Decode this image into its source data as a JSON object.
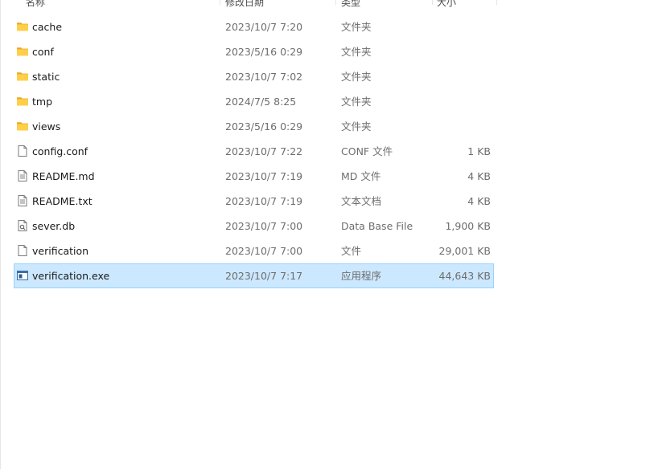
{
  "columns": {
    "name": "名称",
    "date": "修改日期",
    "type": "类型",
    "size": "大小"
  },
  "files": [
    {
      "name": "cache",
      "date": "2023/10/7 7:20",
      "type": "文件夹",
      "size": "",
      "icon": "folder-icon"
    },
    {
      "name": "conf",
      "date": "2023/5/16 0:29",
      "type": "文件夹",
      "size": "",
      "icon": "folder-icon"
    },
    {
      "name": "static",
      "date": "2023/10/7 7:02",
      "type": "文件夹",
      "size": "",
      "icon": "folder-icon"
    },
    {
      "name": "tmp",
      "date": "2024/7/5 8:25",
      "type": "文件夹",
      "size": "",
      "icon": "folder-icon"
    },
    {
      "name": "views",
      "date": "2023/5/16 0:29",
      "type": "文件夹",
      "size": "",
      "icon": "folder-icon"
    },
    {
      "name": "config.conf",
      "date": "2023/10/7 7:22",
      "type": "CONF 文件",
      "size": "1 KB",
      "icon": "file-icon"
    },
    {
      "name": "README.md",
      "date": "2023/10/7 7:19",
      "type": "MD 文件",
      "size": "4 KB",
      "icon": "text-file-icon"
    },
    {
      "name": "README.txt",
      "date": "2023/10/7 7:19",
      "type": "文本文档",
      "size": "4 KB",
      "icon": "text-file-icon"
    },
    {
      "name": "sever.db",
      "date": "2023/10/7 7:00",
      "type": "Data Base File",
      "size": "1,900 KB",
      "icon": "database-file-icon"
    },
    {
      "name": "verification",
      "date": "2023/10/7 7:00",
      "type": "文件",
      "size": "29,001 KB",
      "icon": "file-icon"
    },
    {
      "name": "verification.exe",
      "date": "2023/10/7 7:17",
      "type": "应用程序",
      "size": "44,643 KB",
      "icon": "executable-icon",
      "selected": true
    }
  ],
  "colors": {
    "selection_bg": "#cce8ff",
    "selection_border": "#99d1ff",
    "folder": "#f8c33a"
  }
}
